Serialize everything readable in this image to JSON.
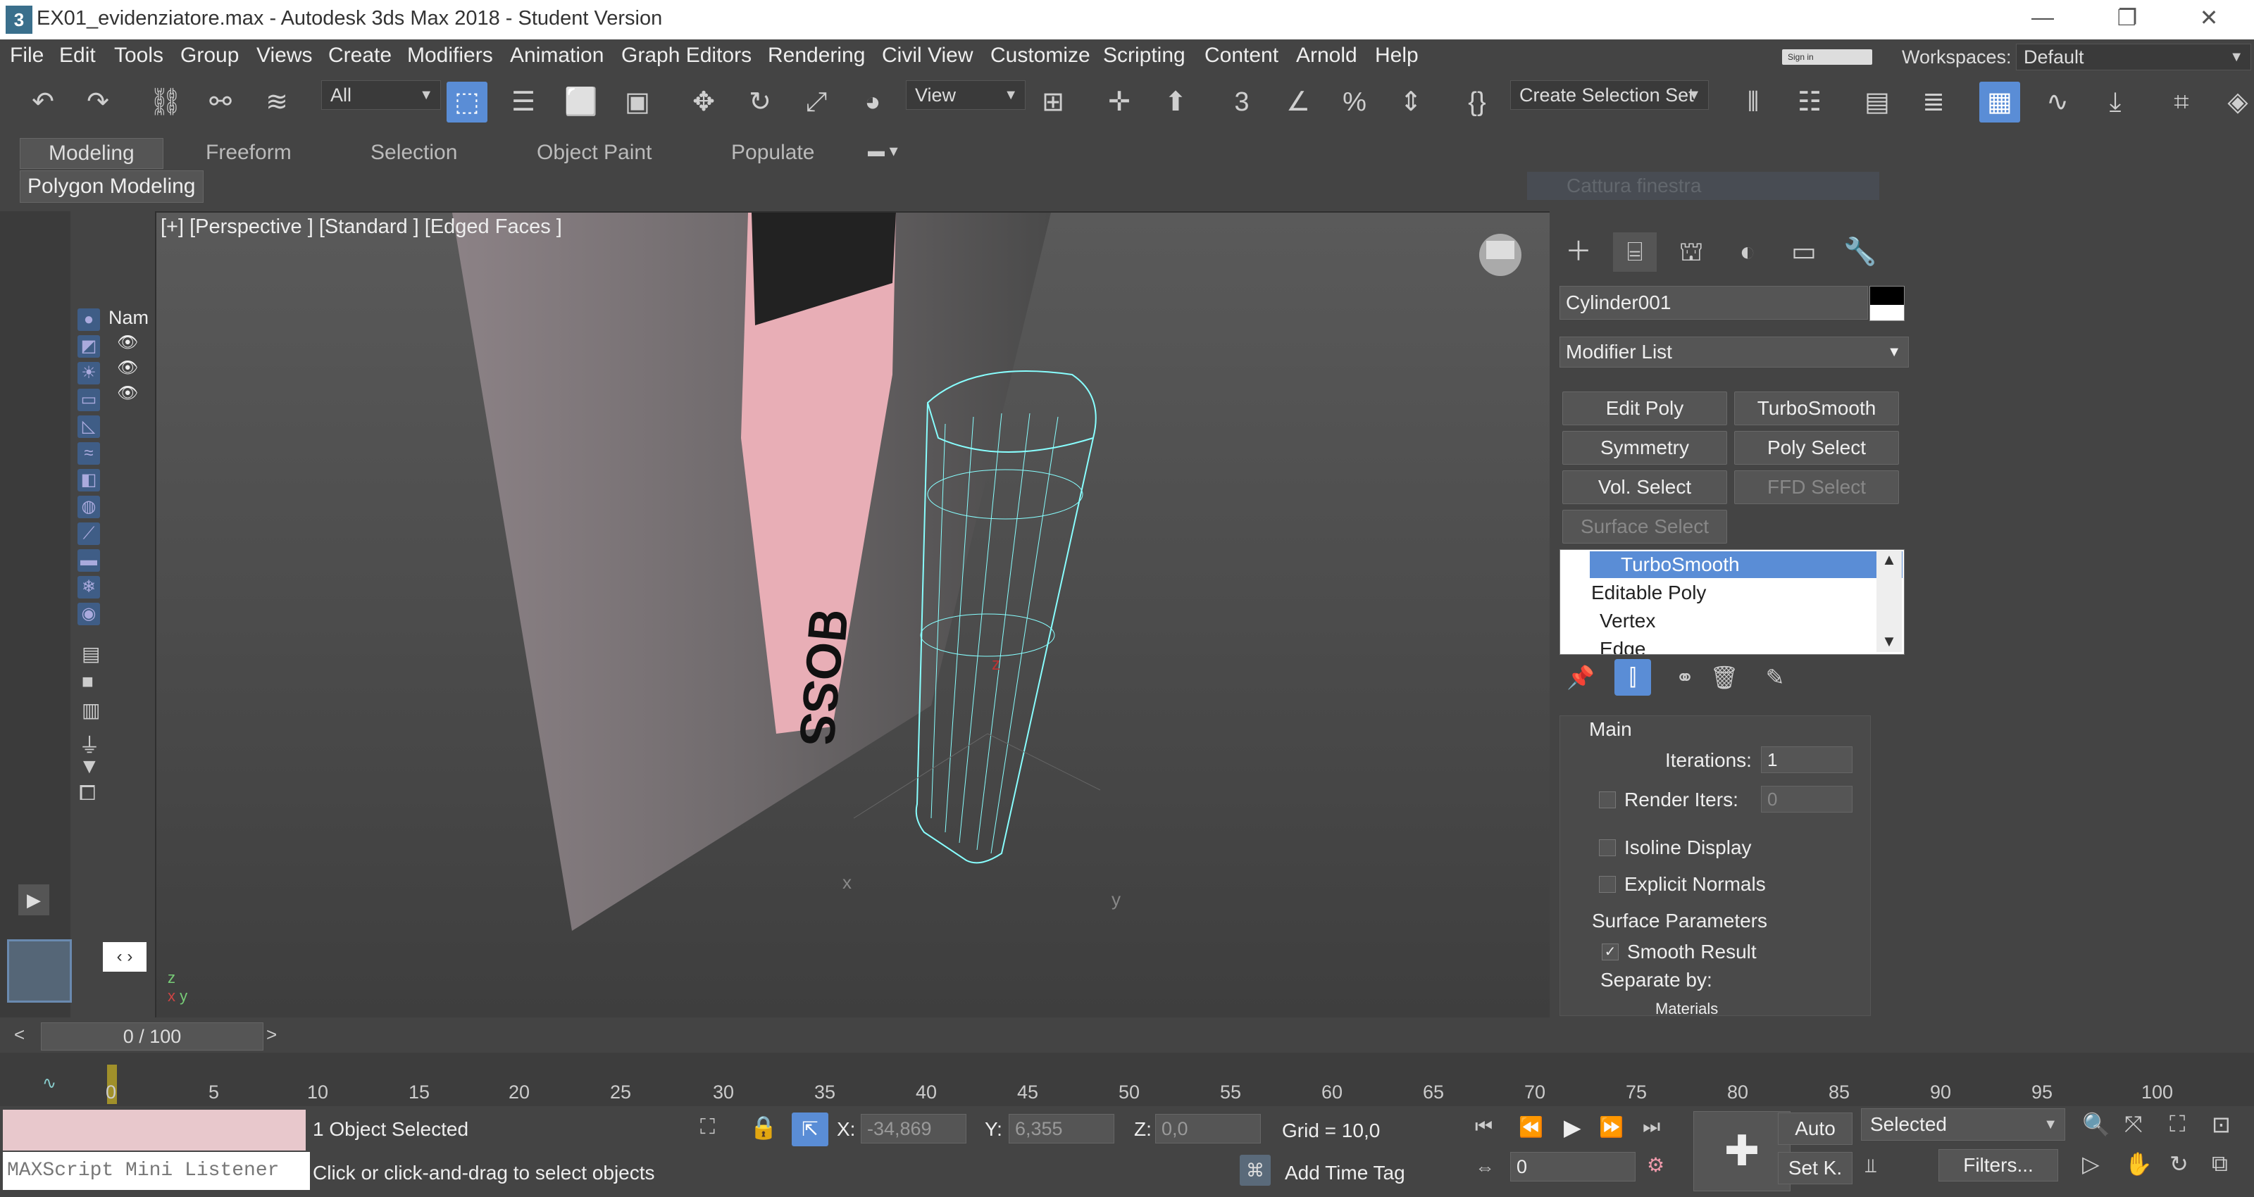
{
  "window": {
    "icon_label": "3",
    "title": "EX01_evidenziatore.max - Autodesk 3ds Max 2018 - Student Version",
    "minimize": "—",
    "restore": "❐",
    "close": "✕"
  },
  "menu": [
    "File",
    "Edit",
    "Tools",
    "Group",
    "Views",
    "Create",
    "Modifiers",
    "Animation",
    "Graph Editors",
    "Rendering",
    "Civil View",
    "Customize",
    "Scripting",
    "Content",
    "Arnold",
    "Help"
  ],
  "signin": "Sign in",
  "workspaces": {
    "label": "Workspaces:",
    "value": "Default"
  },
  "toolbar": {
    "filter_value": "All",
    "refcoord_value": "View",
    "selection_set_value": "Create Selection Set"
  },
  "ribbon": {
    "tabs": [
      "Modeling",
      "Freeform",
      "Selection",
      "Object Paint",
      "Populate"
    ],
    "subtab": "Polygon Modeling",
    "ghost_text": "Cattura finestra"
  },
  "scene": {
    "column": "Nam"
  },
  "viewport": {
    "label": "[+] [Perspective ]  [Standard ]  [Edged Faces ]",
    "axis_x": "x",
    "axis_y": "y",
    "axis_z": "z"
  },
  "command_panel": {
    "object_name": "Cylinder001",
    "modifier_list": "Modifier List",
    "buttons": [
      "Edit Poly",
      "TurboSmooth",
      "Symmetry",
      "Poly Select",
      "Vol. Select",
      "FFD Select",
      "Surface Select"
    ],
    "stack": [
      "TurboSmooth",
      "Editable Poly",
      "Vertex",
      "Edge"
    ],
    "rollout": {
      "group": "Main",
      "iterations_label": "Iterations:",
      "iterations_value": "1",
      "render_iters_label": "Render Iters:",
      "render_iters_value": "0",
      "isoline": "Isoline Display",
      "explicit_normals": "Explicit Normals",
      "surface_params": "Surface Parameters",
      "smooth_result": "Smooth Result",
      "separate_by": "Separate by:",
      "materials": "Materials"
    }
  },
  "timeline": {
    "slider": "0 / 100",
    "ticks": [
      "0",
      "5",
      "10",
      "15",
      "20",
      "25",
      "30",
      "35",
      "40",
      "45",
      "50",
      "55",
      "60",
      "65",
      "70",
      "75",
      "80",
      "85",
      "90",
      "95",
      "100"
    ]
  },
  "status": {
    "maxscript": "MAXScript Mini Listener",
    "selected": "1 Object Selected",
    "prompt": "Click or click-and-drag to select objects",
    "x_label": "X:",
    "x_value": "-34,869",
    "y_label": "Y:",
    "y_value": "6,355",
    "z_label": "Z:",
    "z_value": "0,0",
    "grid": "Grid = 10,0",
    "add_time_tag": "Add Time Tag",
    "auto": "Auto",
    "set_key": "Set K.",
    "key_filter": "Selected",
    "filters": "Filters...",
    "frame": "0"
  }
}
